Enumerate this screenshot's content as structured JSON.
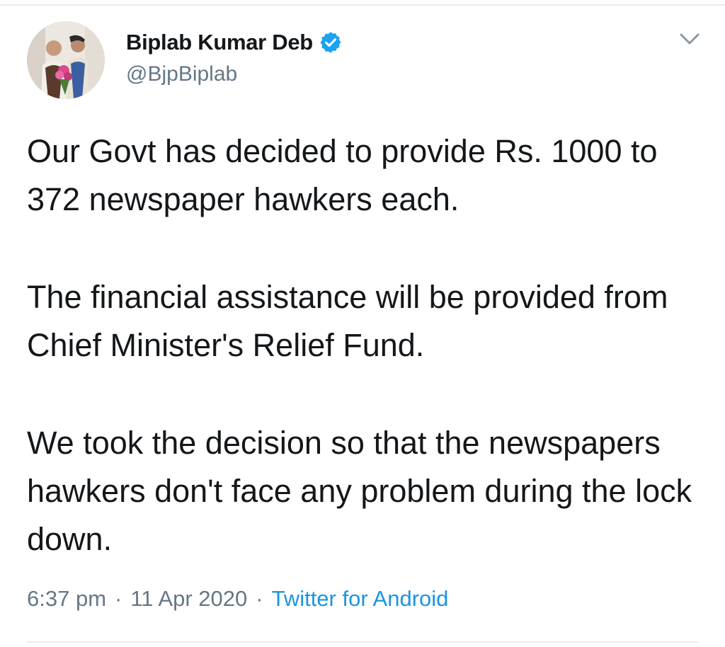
{
  "tweet": {
    "author": {
      "display_name": "Biplab Kumar Deb",
      "handle": "@BjpBiplab",
      "verified": true
    },
    "paragraphs": [
      "Our Govt has decided to provide Rs. 1000 to 372 newspaper hawkers each.",
      "The financial assistance will be provided from Chief Minister's Relief Fund.",
      "We took the decision so that the newspapers hawkers don't face any problem during the lock down."
    ],
    "time": "6:37 pm",
    "date": "11 Apr 2020",
    "separator": "·",
    "source": "Twitter for Android"
  },
  "icons": {
    "verified": "verified-badge-icon",
    "menu": "chevron-down-icon"
  },
  "colors": {
    "text": "#14171a",
    "secondary": "#657786",
    "link": "#1b95e0",
    "verified": "#1da1f2",
    "divider": "#e6ecf0"
  }
}
